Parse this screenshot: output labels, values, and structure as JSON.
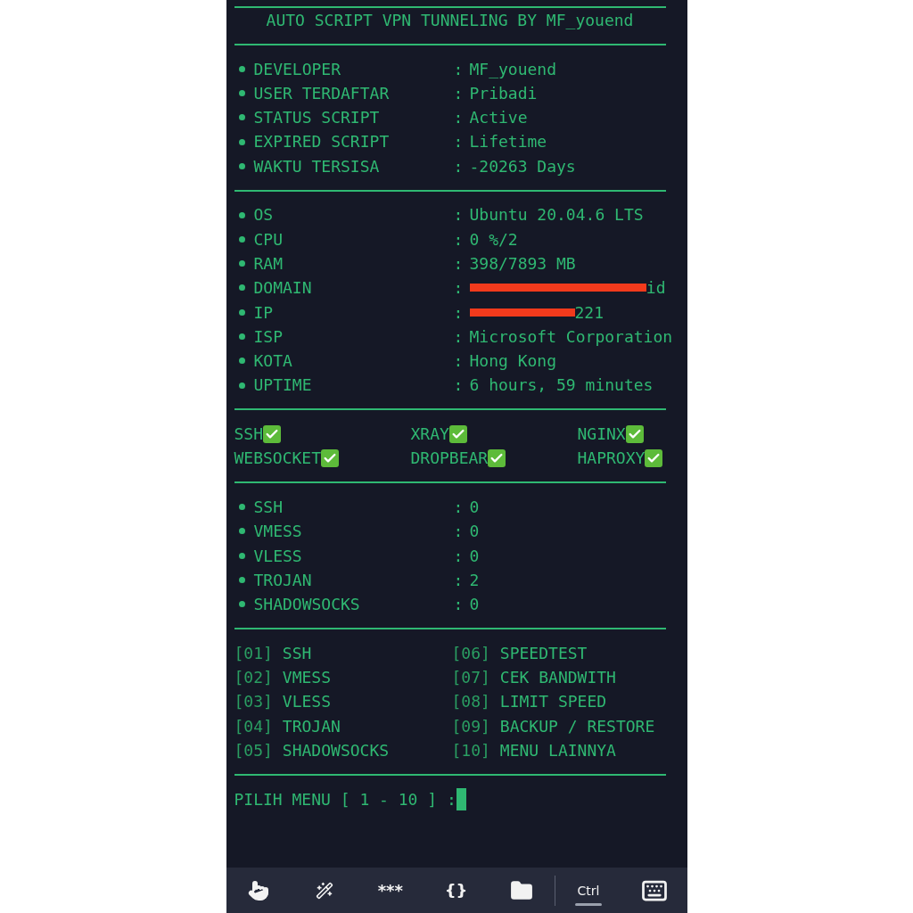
{
  "title": "AUTO SCRIPT VPN TUNNELING BY MF_youend",
  "script_info": [
    {
      "label": "DEVELOPER",
      "value": "MF_youend"
    },
    {
      "label": "USER TERDAFTAR",
      "value": "Pribadi"
    },
    {
      "label": "STATUS SCRIPT",
      "value": "Active"
    },
    {
      "label": "EXPIRED SCRIPT",
      "value": "Lifetime"
    },
    {
      "label": "WAKTU TERSISA",
      "value": "-20263 Days"
    }
  ],
  "system_info": [
    {
      "label": "OS",
      "value": "Ubuntu 20.04.6 LTS",
      "redacted": false
    },
    {
      "label": "CPU",
      "value": "0 %/2",
      "redacted": false
    },
    {
      "label": "RAM",
      "value": "398/7893 MB",
      "redacted": false
    },
    {
      "label": "DOMAIN",
      "value": "id",
      "redacted": true
    },
    {
      "label": "IP",
      "value": "221",
      "redacted": true
    },
    {
      "label": "ISP",
      "value": "Microsoft Corporation",
      "redacted": false
    },
    {
      "label": "KOTA",
      "value": "Hong Kong",
      "redacted": false
    },
    {
      "label": "UPTIME",
      "value": "6 hours, 59 minutes",
      "redacted": false
    }
  ],
  "services": [
    {
      "name": "SSH",
      "ok": true
    },
    {
      "name": "XRAY",
      "ok": true
    },
    {
      "name": "NGINX",
      "ok": true
    },
    {
      "name": "WEBSOCKET",
      "ok": true
    },
    {
      "name": "DROPBEAR",
      "ok": true
    },
    {
      "name": "HAPROXY",
      "ok": true
    }
  ],
  "accounts": [
    {
      "label": "SSH",
      "value": "0"
    },
    {
      "label": "VMESS",
      "value": "0"
    },
    {
      "label": "VLESS",
      "value": "0"
    },
    {
      "label": "TROJAN",
      "value": "2"
    },
    {
      "label": "SHADOWSOCKS",
      "value": "0"
    }
  ],
  "colon": ":",
  "menu": [
    {
      "number": "[01]",
      "label": "SSH"
    },
    {
      "number": "[06]",
      "label": "SPEEDTEST"
    },
    {
      "number": "[02]",
      "label": "VMESS"
    },
    {
      "number": "[07]",
      "label": "CEK BANDWITH"
    },
    {
      "number": "[03]",
      "label": "VLESS"
    },
    {
      "number": "[08]",
      "label": "LIMIT SPEED"
    },
    {
      "number": "[04]",
      "label": "TROJAN"
    },
    {
      "number": "[09]",
      "label": "BACKUP / RESTORE"
    },
    {
      "number": "[05]",
      "label": "SHADOWSOCKS"
    },
    {
      "number": "[10]",
      "label": "MENU LAINNYA"
    }
  ],
  "prompt": "PILIH MENU [ 1 - 10 ] :",
  "toolbar": [
    {
      "kind": "touch",
      "selected": false
    },
    {
      "kind": "wand",
      "selected": false
    },
    {
      "kind": "text",
      "label": "***",
      "selected": false
    },
    {
      "kind": "text",
      "label": "{}",
      "selected": false
    },
    {
      "kind": "folder",
      "selected": false
    },
    {
      "kind": "text",
      "label": "Ctrl",
      "selected": true
    },
    {
      "kind": "keyboard",
      "selected": false
    }
  ]
}
